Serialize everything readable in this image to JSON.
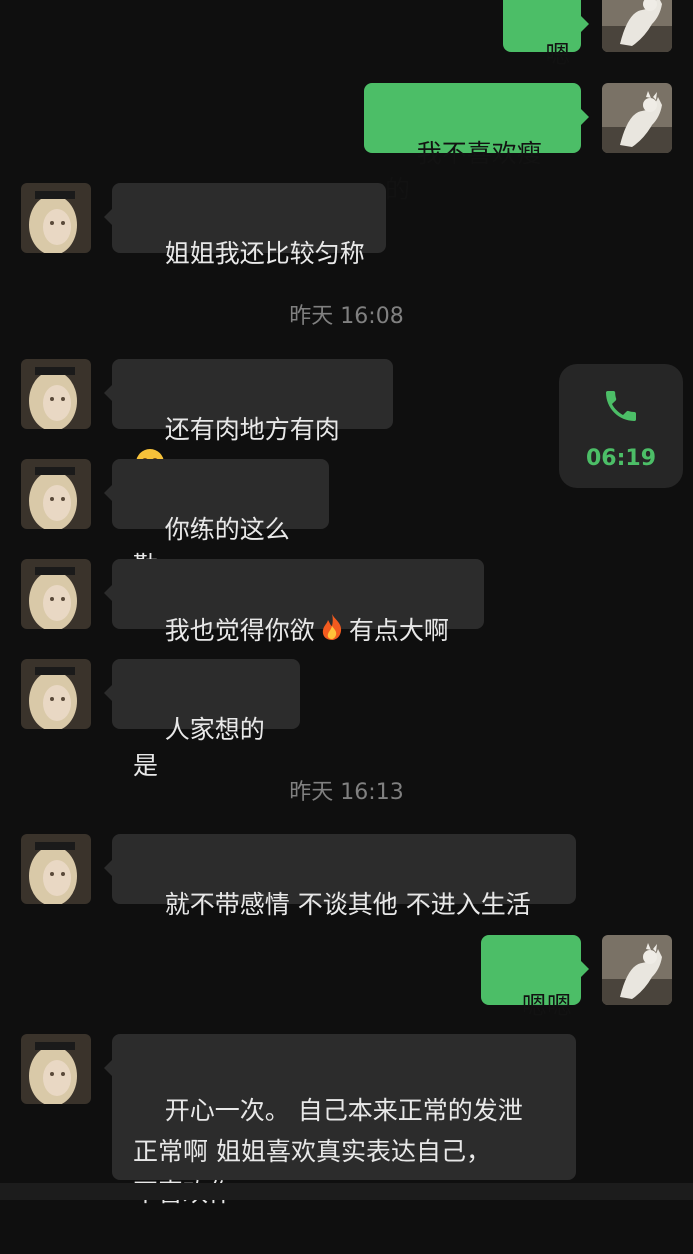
{
  "messages": [
    {
      "id": "m1",
      "side": "me",
      "text": "嗯"
    },
    {
      "id": "m2",
      "side": "me",
      "text": "我不喜欢瘦的"
    },
    {
      "id": "m3",
      "side": "other",
      "text": "姐姐我还比较匀称"
    },
    {
      "id": "t1",
      "text": "昨天 16:08"
    },
    {
      "id": "m4",
      "side": "other",
      "text_before": "还有肉地方有肉",
      "emoji": "blushing-smile-emoji"
    },
    {
      "id": "m5",
      "side": "other",
      "text": "你练的这么勤"
    },
    {
      "id": "m6",
      "side": "other",
      "text_before": "我也觉得你欲",
      "emoji": "fire-emoji",
      "text_after": "有点大啊"
    },
    {
      "id": "m7",
      "side": "other",
      "text": "人家想的是"
    },
    {
      "id": "t2",
      "text": "昨天 16:13"
    },
    {
      "id": "m8",
      "side": "other",
      "text": "就不带感情 不谈其他 不进入生活"
    },
    {
      "id": "m9",
      "side": "me",
      "text": "嗯嗯"
    },
    {
      "id": "m10",
      "side": "other",
      "text": "开心一次。 自己本来正常的发泄\n正常啊 姐姐喜欢真实表达自己，\n不喜欢作"
    }
  ],
  "call": {
    "icon": "phone-icon",
    "duration": "06:19",
    "color": "#4cbe67"
  },
  "colors": {
    "background": "#0f0f0f",
    "bubble_me": "#4cbe67",
    "bubble_other": "#2c2c2c"
  },
  "avatars": {
    "me": "white-cat-avatar",
    "other": "blonde-woman-avatar"
  }
}
